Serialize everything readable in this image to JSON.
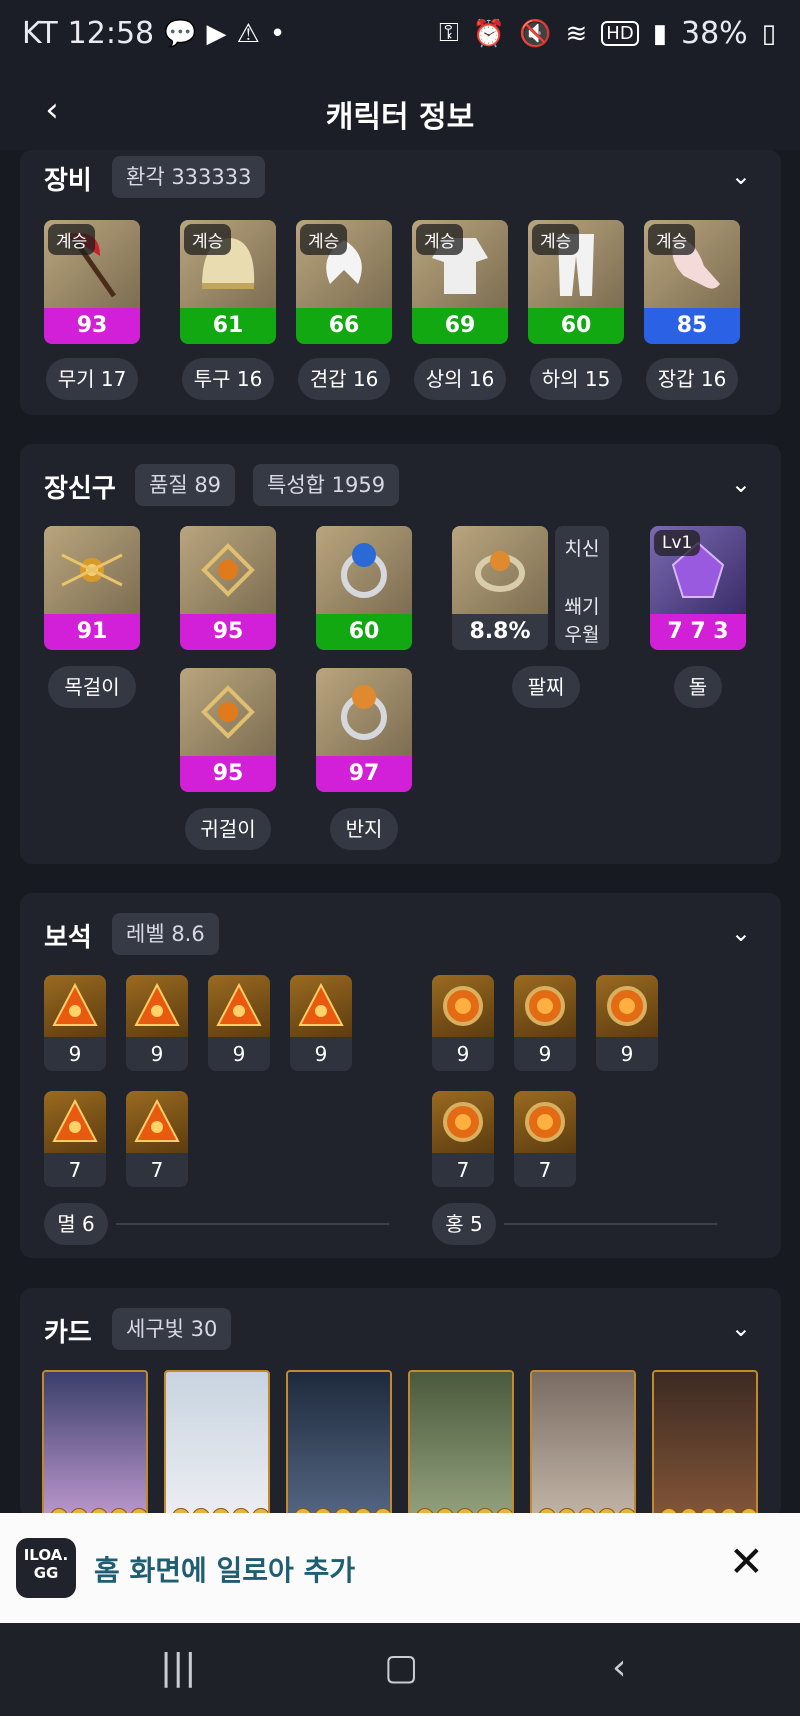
{
  "status": {
    "carrier": "KT",
    "time": "12:58",
    "battery": "38%"
  },
  "header": {
    "title": "캐릭터 정보",
    "back": "‹"
  },
  "equipment": {
    "title": "장비",
    "chip": "환각 333333",
    "items": [
      {
        "badge": "계승",
        "value": "93",
        "color": "#d21fd8",
        "label": "무기 17",
        "art": "axe"
      },
      {
        "badge": "계승",
        "value": "61",
        "color": "#11a811",
        "label": "투구 16",
        "art": "helm"
      },
      {
        "badge": "계승",
        "value": "66",
        "color": "#11a811",
        "label": "견갑 16",
        "art": "shoulder"
      },
      {
        "badge": "계승",
        "value": "69",
        "color": "#11a811",
        "label": "상의 16",
        "art": "top"
      },
      {
        "badge": "계승",
        "value": "60",
        "color": "#11a811",
        "label": "하의 15",
        "art": "pants"
      },
      {
        "badge": "계승",
        "value": "85",
        "color": "#2b62e5",
        "label": "장갑 16",
        "art": "glove"
      }
    ]
  },
  "accessories": {
    "title": "장신구",
    "chip1": "품질 89",
    "chip2": "특성합 1959",
    "necklace": {
      "value": "91",
      "color": "#d21fd8",
      "label": "목걸이"
    },
    "earring1": {
      "value": "95",
      "color": "#d21fd8"
    },
    "earring2": {
      "value": "95",
      "color": "#d21fd8"
    },
    "earring_label": "귀걸이",
    "ring1": {
      "value": "60",
      "color": "#11a811"
    },
    "ring2": {
      "value": "97",
      "color": "#d21fd8"
    },
    "ring_label": "반지",
    "bracelet": {
      "value": "8.8%",
      "label": "팔찌",
      "tags": [
        "치신",
        "쐐기",
        "우월"
      ]
    },
    "stone": {
      "badge": "Lv1",
      "value": "7 7 3",
      "color": "#d21fd8",
      "label": "돌"
    }
  },
  "gems": {
    "title": "보석",
    "chip": "레벨 8.6",
    "left": [
      "9",
      "9",
      "9",
      "9",
      "7",
      "7"
    ],
    "right": [
      "9",
      "9",
      "9",
      "7",
      "7"
    ],
    "left_label": "멸 6",
    "right_label": "홍 5"
  },
  "cards": {
    "title": "카드",
    "chip": "세구빛 30",
    "count": 6
  },
  "banner": {
    "logo": "ILOA.\nGG",
    "text": "홈 화면에 일로아 추가",
    "close": "✕"
  }
}
